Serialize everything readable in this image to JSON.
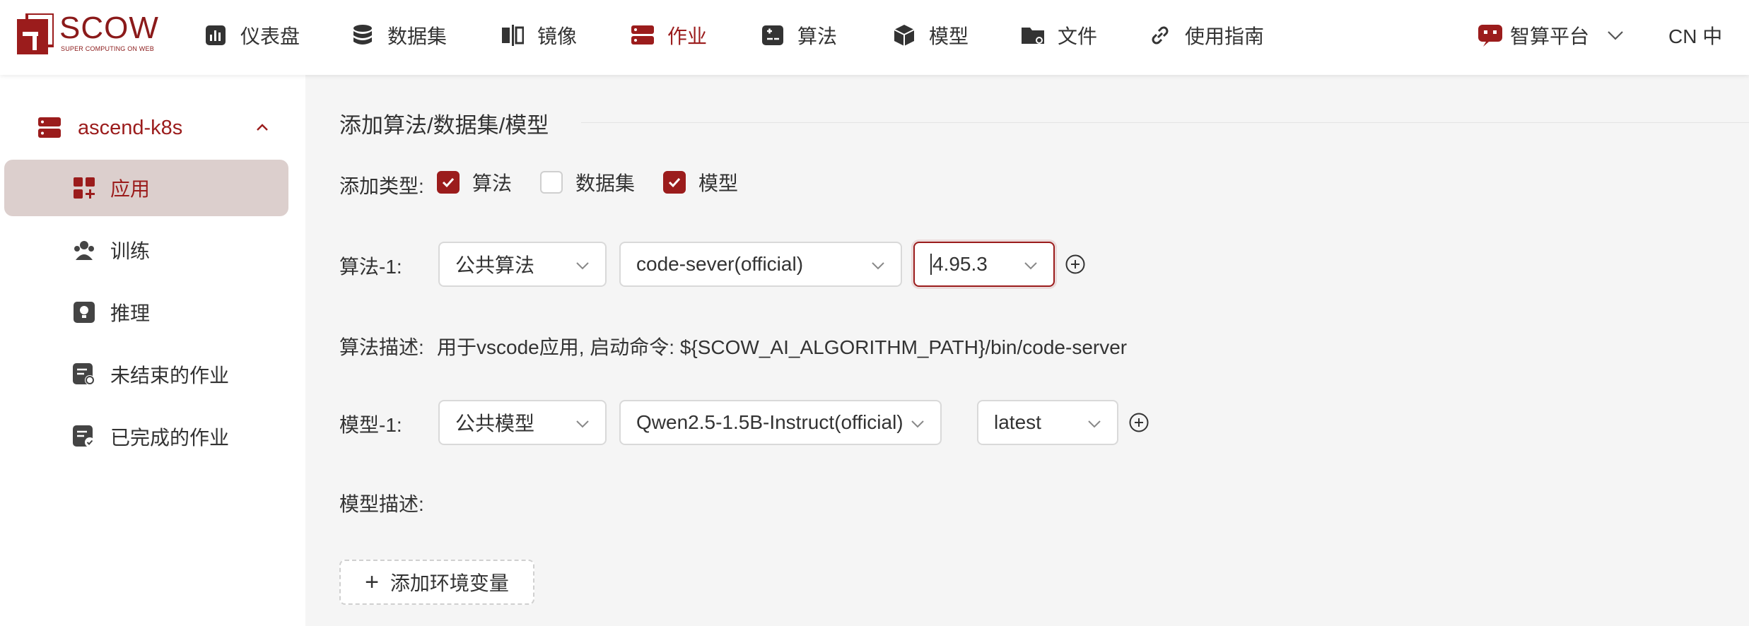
{
  "header": {
    "logo_title": "SCOW",
    "logo_subtitle": "SUPER COMPUTING ON WEB",
    "nav": [
      {
        "label": "仪表盘",
        "icon": "dashboard-icon"
      },
      {
        "label": "数据集",
        "icon": "database-icon"
      },
      {
        "label": "镜像",
        "icon": "image-icon"
      },
      {
        "label": "作业",
        "icon": "job-icon",
        "active": true
      },
      {
        "label": "算法",
        "icon": "algorithm-icon"
      },
      {
        "label": "模型",
        "icon": "model-icon"
      },
      {
        "label": "文件",
        "icon": "folder-icon"
      },
      {
        "label": "使用指南",
        "icon": "link-icon"
      }
    ],
    "platform_label": "智算平台",
    "language": "CN 中"
  },
  "sidebar": {
    "cluster": "ascend-k8s",
    "items": [
      {
        "label": "应用",
        "icon": "apps-icon",
        "active": true
      },
      {
        "label": "训练",
        "icon": "training-icon"
      },
      {
        "label": "推理",
        "icon": "inference-icon"
      },
      {
        "label": "未结束的作业",
        "icon": "running-jobs-icon"
      },
      {
        "label": "已完成的作业",
        "icon": "finished-jobs-icon"
      }
    ]
  },
  "form": {
    "section_title": "添加算法/数据集/模型",
    "add_type_label": "添加类型:",
    "types": [
      {
        "label": "算法",
        "checked": true
      },
      {
        "label": "数据集",
        "checked": false
      },
      {
        "label": "模型",
        "checked": true
      }
    ],
    "algorithm": {
      "label": "算法-1:",
      "source": "公共算法",
      "name": "code-sever(official)",
      "version": "4.95.3",
      "desc_label": "算法描述:",
      "desc_text": "用于vscode应用, 启动命令: ${SCOW_AI_ALGORITHM_PATH}/bin/code-server"
    },
    "model": {
      "label": "模型-1:",
      "source": "公共模型",
      "name": "Qwen2.5-1.5B-Instruct(official)",
      "version": "latest",
      "desc_label": "模型描述:"
    },
    "add_env_label": "添加环境变量"
  },
  "colors": {
    "accent": "#9b1c1c",
    "sidebar_active_bg": "#dccfcd",
    "main_bg": "#f5f5f5"
  }
}
